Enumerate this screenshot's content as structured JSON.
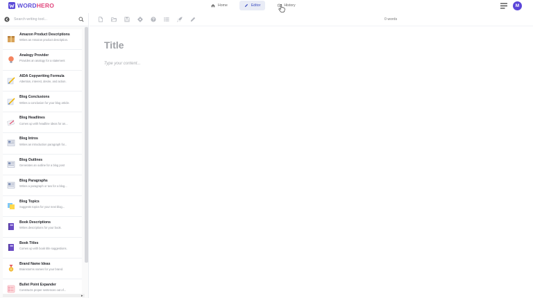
{
  "brand": {
    "word": "WORD",
    "hero": "HERO",
    "colors": {
      "primary": "#5b4bd8",
      "accent": "#e0457b"
    }
  },
  "nav": {
    "items": [
      {
        "label": "Home",
        "icon": "home-icon",
        "active": false
      },
      {
        "label": "Editor",
        "icon": "pencil-icon",
        "active": true
      },
      {
        "label": "History",
        "icon": "history-icon",
        "active": false
      }
    ]
  },
  "user": {
    "avatar_letter": "M",
    "avatar_color": "#5b46d9"
  },
  "sidebar": {
    "search_placeholder": "Search writing tool...",
    "tools": [
      {
        "name": "Amazon Product Descriptions",
        "desc": "Writes an Amazon product description.",
        "icon": "box-icon"
      },
      {
        "name": "Analogy Provider",
        "desc": "Provides an analogy for a statement",
        "icon": "lightbulb-icon"
      },
      {
        "name": "AIDA Copywriting Formula",
        "desc": "Attention, interest, desire, and action.",
        "icon": "pen-paper-icon"
      },
      {
        "name": "Blog Conclusions",
        "desc": "Writes a conclusion for your blog article.",
        "icon": "pen-paper-icon"
      },
      {
        "name": "Blog Headlines",
        "desc": "Comes up with headline ideas for an...",
        "icon": "notes-icon"
      },
      {
        "name": "Blog Intros",
        "desc": "Writes an introduction paragraph for...",
        "icon": "newspaper-icon"
      },
      {
        "name": "Blog Outlines",
        "desc": "Generates an outline for a blog post",
        "icon": "newspaper-icon"
      },
      {
        "name": "Blog Paragraphs",
        "desc": "Writes a paragraph or two for a blog...",
        "icon": "newspaper-icon"
      },
      {
        "name": "Blog Topics",
        "desc": "Suggests topics for your next blog...",
        "icon": "sticky-notes-icon"
      },
      {
        "name": "Book Descriptions",
        "desc": "Writes descriptions for your book.",
        "icon": "book-icon"
      },
      {
        "name": "Book Titles",
        "desc": "Comes up with book title suggestions.",
        "icon": "book-icon"
      },
      {
        "name": "Brand Name Ideas",
        "desc": "Brainstorms names for your brand.",
        "icon": "medal-icon"
      },
      {
        "name": "Bullet Point Expander",
        "desc": "Constructs proper sentences out of...",
        "icon": "list-icon"
      }
    ]
  },
  "toolbar": {
    "icons": [
      "new-file-icon",
      "open-folder-icon",
      "save-icon",
      "settings-icon",
      "help-icon",
      "list-icon",
      "rocket-icon",
      "pen-icon"
    ]
  },
  "editor": {
    "word_count": "0 words",
    "title_placeholder": "Title",
    "content_placeholder": "Type your content..."
  }
}
